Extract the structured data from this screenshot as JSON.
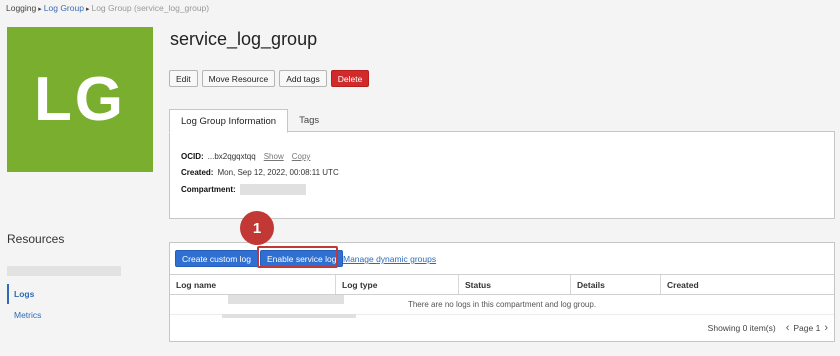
{
  "breadcrumb": {
    "root": "Logging",
    "parent": "Log Group",
    "current": "Log Group (service_log_group)"
  },
  "tile": {
    "initials": "LG",
    "color": "#7aae2e"
  },
  "page": {
    "title": "service_log_group"
  },
  "actions": {
    "edit": "Edit",
    "move": "Move Resource",
    "add_tags": "Add tags",
    "delete": "Delete"
  },
  "tabs": [
    "Log Group Information",
    "Tags"
  ],
  "info": {
    "ocid_label": "OCID:",
    "ocid_value": "...bx2qgqxtqq",
    "show": "Show",
    "copy": "Copy",
    "created_label": "Created:",
    "created_value": "Mon, Sep 12, 2022, 00:08:11 UTC",
    "compartment_label": "Compartment:"
  },
  "sidebar": {
    "title": "Resources",
    "logs": "Logs",
    "metrics": "Metrics"
  },
  "logs": {
    "create_button": "Create custom log",
    "enable_button": "Enable service log",
    "manage_link": "Manage dynamic groups",
    "columns": [
      "Log name",
      "Log type",
      "Status",
      "Details",
      "Created"
    ],
    "empty_message": "There are no logs in this compartment and log group.",
    "showing": "Showing 0 item(s)",
    "page": "Page 1"
  },
  "callout": {
    "number": "1",
    "color": "#c23834"
  }
}
